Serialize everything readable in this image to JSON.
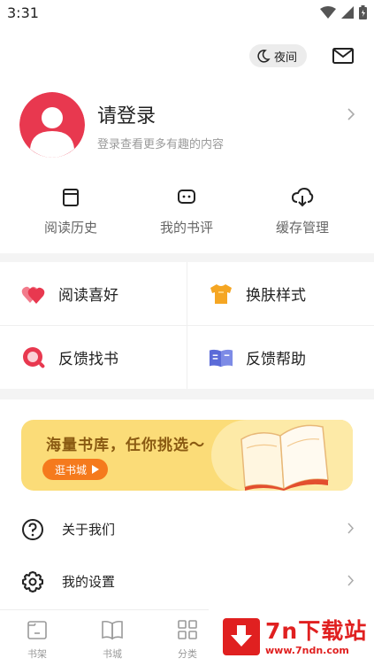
{
  "status_bar": {
    "time": "3:31"
  },
  "topbar": {
    "night_label": "夜间"
  },
  "profile": {
    "title": "请登录",
    "subtitle": "登录查看更多有趣的内容"
  },
  "quick_actions": [
    {
      "label": "阅读历史",
      "icon": "book-history-icon"
    },
    {
      "label": "我的书评",
      "icon": "comment-icon"
    },
    {
      "label": "缓存管理",
      "icon": "cloud-download-icon"
    }
  ],
  "grid": [
    {
      "label": "阅读喜好",
      "icon": "hearts-icon",
      "color": "#e8384f"
    },
    {
      "label": "换肤样式",
      "icon": "tshirt-icon",
      "color": "#f5a623"
    },
    {
      "label": "反馈找书",
      "icon": "search-icon",
      "color": "#e8384f"
    },
    {
      "label": "反馈帮助",
      "icon": "open-book-icon",
      "color": "#5b6bd8"
    }
  ],
  "banner": {
    "title": "海量书库，任你挑选～",
    "button": "逛书城"
  },
  "list": [
    {
      "label": "关于我们",
      "icon": "question-icon"
    },
    {
      "label": "我的设置",
      "icon": "gear-icon"
    }
  ],
  "bottom_nav": [
    {
      "label": "书架",
      "icon": "bookshelf-icon"
    },
    {
      "label": "书城",
      "icon": "bookstore-icon"
    },
    {
      "label": "分类",
      "icon": "category-icon"
    }
  ],
  "watermark": {
    "title": "7n下载站",
    "url": "www.7ndn.com"
  },
  "colors": {
    "accent": "#e8384f",
    "banner_bg": "#fbdc78",
    "banner_button": "#f57a1d",
    "watermark": "#e02020"
  }
}
